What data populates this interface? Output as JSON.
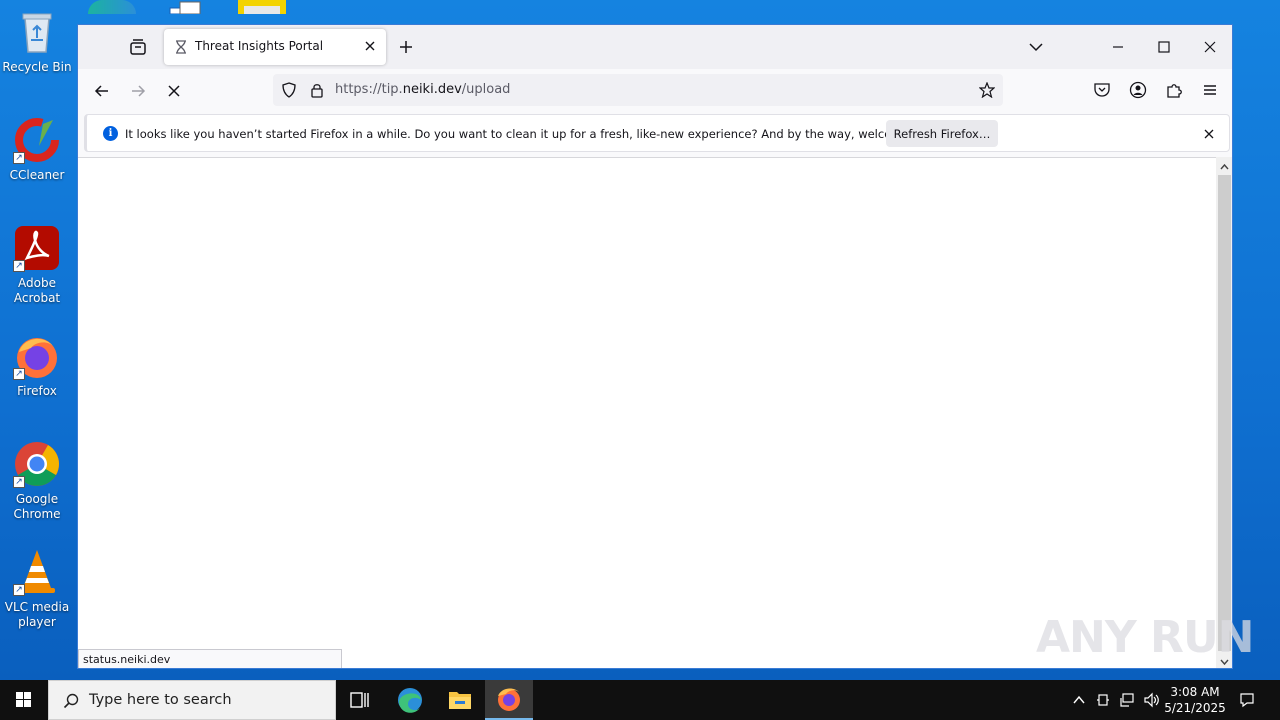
{
  "desktop": {
    "icons": [
      {
        "label": "Recycle Bin"
      },
      {
        "label": "CCleaner"
      },
      {
        "label": "Adobe\nAcrobat"
      },
      {
        "label": "Firefox"
      },
      {
        "label": "Google\nChrome"
      },
      {
        "label": "VLC media\nplayer"
      }
    ]
  },
  "browser": {
    "tab": {
      "title": "Threat Insights Portal",
      "icon": "hourglass-icon"
    },
    "url": {
      "scheme_prefix": "https://tip.",
      "host": "neiki.dev",
      "path": "/upload"
    },
    "notification": {
      "message": "It looks like you haven’t started Firefox in a while. Do you want to clean it up for a fresh, like-new experience? And by the way, welcome back!",
      "button_label": "Refresh Firefox…"
    },
    "status_text": "status.neiki.dev"
  },
  "watermark": "ANY RUN",
  "taskbar": {
    "search_placeholder": "Type here to search",
    "time": "3:08 AM",
    "date": "5/21/2025"
  },
  "colors": {
    "desktop_bg": "#0f6fd0",
    "info_blue": "#0060df",
    "taskbar_bg": "#101010"
  }
}
